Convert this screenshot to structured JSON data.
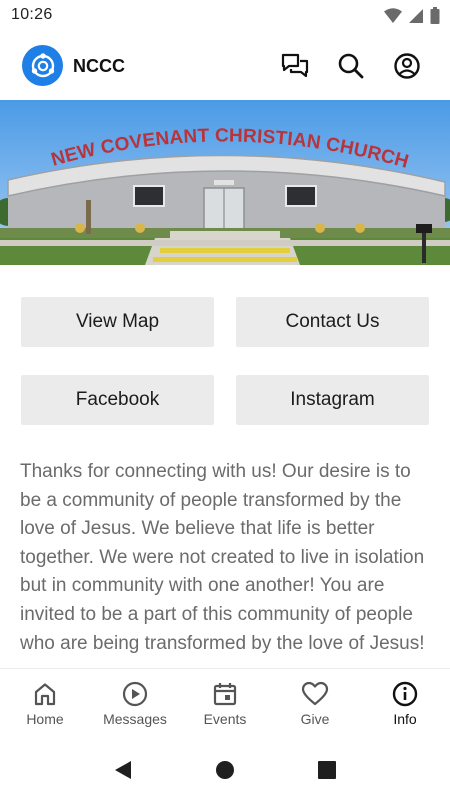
{
  "status_bar": {
    "time": "10:26",
    "icons": [
      "wifi-icon",
      "signal-icon",
      "battery-icon"
    ]
  },
  "app_bar": {
    "title": "NCCC",
    "actions": [
      "chat-icon",
      "search-icon",
      "account-icon"
    ]
  },
  "hero": {
    "sign_text": "NEW COVENANT CHRISTIAN CHURCH"
  },
  "buttons": {
    "view_map": "View Map",
    "contact_us": "Contact Us",
    "facebook": "Facebook",
    "instagram": "Instagram"
  },
  "description": "Thanks for connecting with us! Our desire is to be a community of people transformed by the love of Jesus. We believe that life is better together. We were not created to live in isolation but in community with one another! You are invited to be a part of this community of people who are being transformed by the love of Jesus!",
  "bottom_nav": {
    "items": [
      {
        "label": "Home",
        "icon": "home-icon"
      },
      {
        "label": "Messages",
        "icon": "play-circle-icon"
      },
      {
        "label": "Events",
        "icon": "calendar-icon"
      },
      {
        "label": "Give",
        "icon": "heart-icon"
      },
      {
        "label": "Info",
        "icon": "info-icon"
      }
    ],
    "active": "Info"
  },
  "colors": {
    "brand": "#1e7fe6",
    "button_bg": "#ebebeb",
    "sign_text": "#b8343a",
    "body_text": "#6b6b6b"
  }
}
